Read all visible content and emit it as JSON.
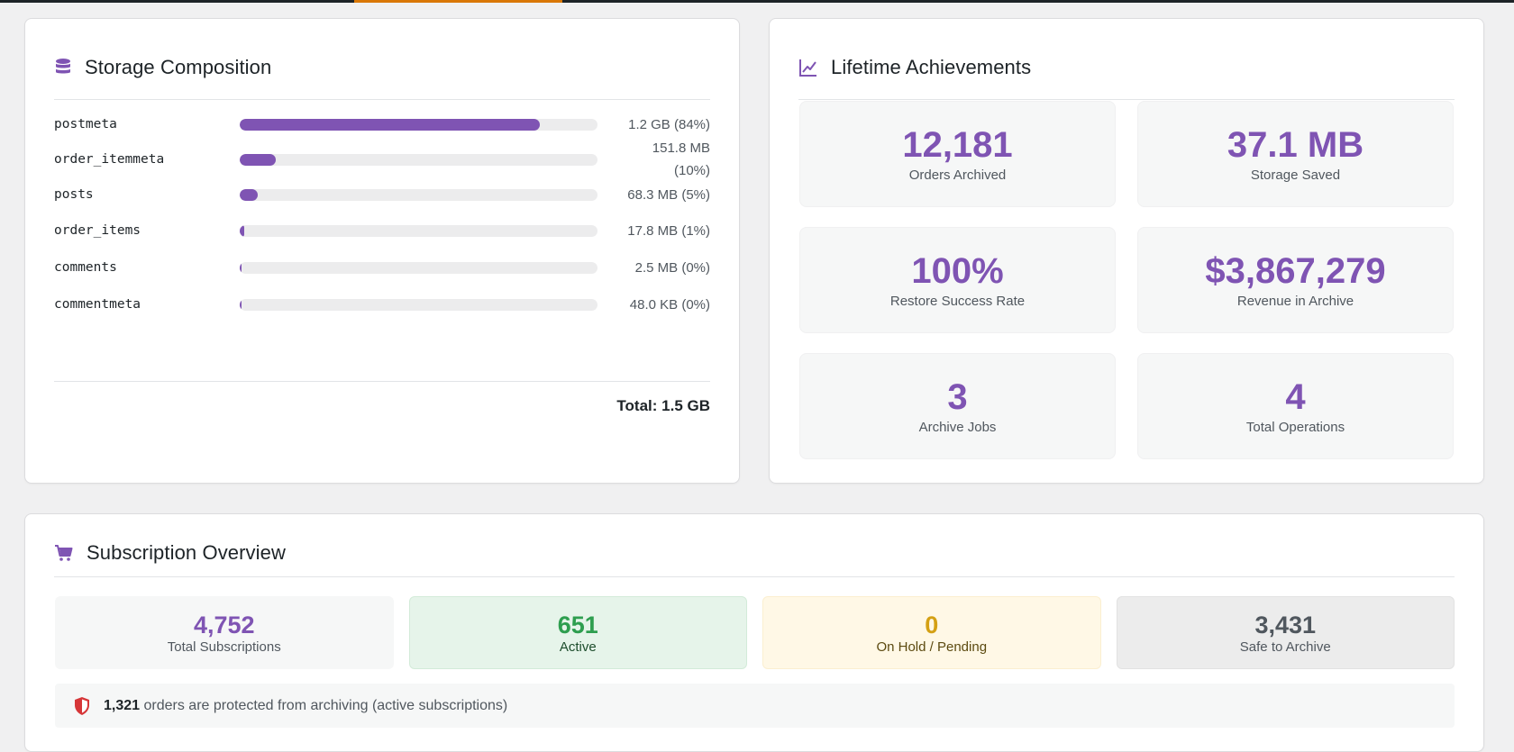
{
  "storage": {
    "title": "Storage Composition",
    "icon": "database-icon",
    "rows": [
      {
        "name": "postmeta",
        "value": "1.2 GB (84%)",
        "percent": 84
      },
      {
        "name": "order_itemmeta",
        "value_line1": "151.8 MB",
        "value_line2": "(10%)",
        "percent": 10
      },
      {
        "name": "posts",
        "value": "68.3 MB (5%)",
        "percent": 5
      },
      {
        "name": "order_items",
        "value": "17.8 MB (1%)",
        "percent": 1
      },
      {
        "name": "comments",
        "value": "2.5 MB (0%)",
        "percent": 0
      },
      {
        "name": "commentmeta",
        "value": "48.0 KB (0%)",
        "percent": 0
      }
    ],
    "total": "Total: 1.5 GB"
  },
  "achievements": {
    "title": "Lifetime Achievements",
    "icon": "chart-line-icon",
    "tiles": [
      {
        "value": "12,181",
        "label": "Orders Archived"
      },
      {
        "value": "37.1 MB",
        "label": "Storage Saved"
      },
      {
        "value": "100%",
        "label": "Restore Success Rate"
      },
      {
        "value": "$3,867,279",
        "label": "Revenue in Archive"
      },
      {
        "value": "3",
        "label": "Archive Jobs"
      },
      {
        "value": "4",
        "label": "Total Operations"
      }
    ]
  },
  "subscriptions": {
    "title": "Subscription Overview",
    "icon": "cart-icon",
    "tiles": [
      {
        "value": "4,752",
        "label": "Total Subscriptions"
      },
      {
        "value": "651",
        "label": "Active"
      },
      {
        "value": "0",
        "label": "On Hold / Pending"
      },
      {
        "value": "3,431",
        "label": "Safe to Archive"
      }
    ],
    "protected": {
      "count": "1,321",
      "text": "orders are protected from archiving (active subscriptions)",
      "icon": "shield-icon"
    }
  },
  "colors": {
    "accent": "#7f54b3",
    "active": "#2e9e4f",
    "hold": "#d4a014",
    "tab_indicator": "#d97706"
  }
}
